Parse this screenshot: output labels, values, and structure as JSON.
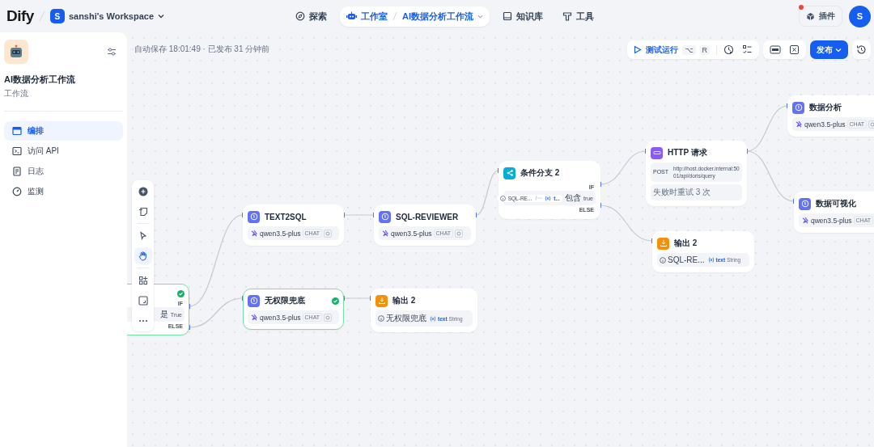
{
  "header": {
    "logo": "Dify",
    "workspace": {
      "initial": "S",
      "name": "sanshi's Workspace"
    },
    "nav": [
      {
        "kind": "explore",
        "label": "探索",
        "selected": false
      },
      {
        "kind": "studio",
        "label": "工作室",
        "selected": true,
        "crumb": "AI数据分析工作流"
      },
      {
        "kind": "knowledge",
        "label": "知识库",
        "selected": false
      },
      {
        "kind": "tools",
        "label": "工具",
        "selected": false
      }
    ],
    "plugins": {
      "label": "插件",
      "has_update": true
    },
    "avatar": "S"
  },
  "sidebar": {
    "app_name": "AI数据分析工作流",
    "app_type": "工作流",
    "items": [
      {
        "kind": "orchestrate",
        "label": "编排",
        "selected": true
      },
      {
        "kind": "api",
        "label": "访问 API",
        "selected": false
      },
      {
        "kind": "logs",
        "label": "日志",
        "selected": false
      },
      {
        "kind": "monitor",
        "label": "监测",
        "selected": false
      }
    ]
  },
  "canvas": {
    "status": "自动保存 18:01:49 · 已发布 31 分钟前",
    "run": {
      "label": "测试运行",
      "keys": [
        "⌥",
        "R"
      ]
    },
    "publish": "发布",
    "tools": [
      [
        {
          "kind": "add"
        },
        {
          "kind": "note"
        }
      ],
      [
        {
          "kind": "pointer",
          "selected": false
        },
        {
          "kind": "hand",
          "selected": true
        }
      ],
      [
        {
          "kind": "organize"
        },
        {
          "kind": "fit"
        },
        {
          "kind": "more"
        }
      ]
    ],
    "nodes": [
      {
        "kind": "condition",
        "succeeded": true,
        "branches": [
          "IF",
          "ELSE"
        ],
        "conditions": [
          {
            "op": "是",
            "value": "True"
          }
        ]
      },
      {
        "kind": "llm",
        "title": "TEXT2SQL",
        "succeeded": false,
        "model": "qwen3.5-plus",
        "mode": "CHAT"
      },
      {
        "kind": "llm",
        "title": "SQL-REVIEWER",
        "succeeded": false,
        "model": "qwen3.5-plus",
        "mode": "CHAT"
      },
      {
        "kind": "llm",
        "title": "无权限兜底",
        "succeeded": true,
        "model": "qwen3.5-plus",
        "mode": "CHAT"
      },
      {
        "kind": "output",
        "title": "输出 2",
        "succeeded": false,
        "vars": [
          {
            "source": "无权限兜底",
            "name": "text",
            "type": "String"
          }
        ]
      },
      {
        "kind": "condition",
        "title": "条件分支 2",
        "succeeded": false,
        "branches": [
          "IF",
          "ELSE"
        ],
        "conditions": [
          {
            "source": "SQL-RE...",
            "name": "t...",
            "op": "包含",
            "value": "true"
          }
        ]
      },
      {
        "kind": "http",
        "title": "HTTP 请求",
        "succeeded": false,
        "method": "POST",
        "url": "http://host.docker.internal:5001/api/doris/query",
        "retry": "失败时重试 3 次"
      },
      {
        "kind": "output",
        "title": "输出 2",
        "succeeded": false,
        "vars": [
          {
            "source": "SQL-RE...",
            "name": "text",
            "type": "String"
          }
        ]
      },
      {
        "kind": "llm",
        "title": "数据分析",
        "succeeded": false,
        "model": "qwen3.5-plus",
        "mode": "CHAT"
      },
      {
        "kind": "llm",
        "title": "数据可视化",
        "succeeded": false,
        "model": "qwen3.5-plus",
        "mode": "CHAT"
      }
    ]
  }
}
